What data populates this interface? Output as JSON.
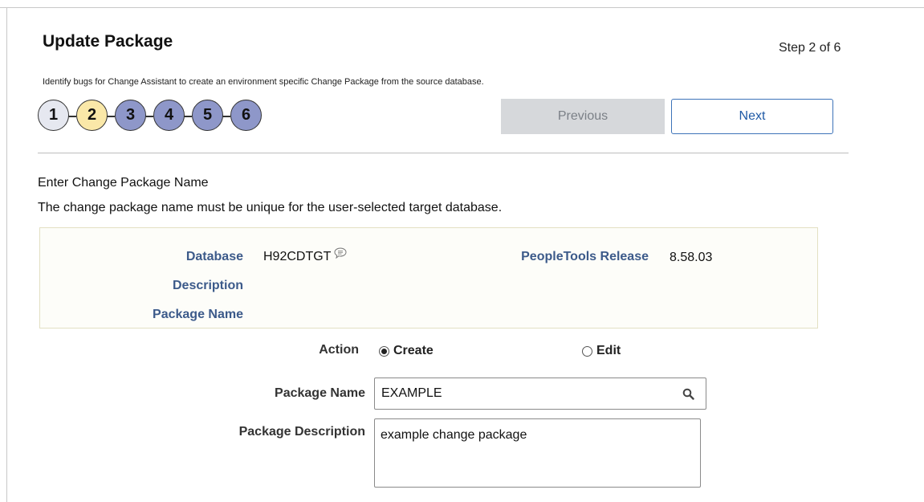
{
  "header": {
    "title": "Update Package",
    "step_indicator": "Step 2 of 6",
    "instructions": "Identify bugs for Change Assistant to create an environment specific Change Package from the source database."
  },
  "steps": [
    {
      "label": "1",
      "state": "complete",
      "color": "#e6e8f0"
    },
    {
      "label": "2",
      "state": "current",
      "color": "#fae8a8"
    },
    {
      "label": "3",
      "state": "upcoming",
      "color": "#8e97c9"
    },
    {
      "label": "4",
      "state": "upcoming",
      "color": "#8e97c9"
    },
    {
      "label": "5",
      "state": "upcoming",
      "color": "#8e97c9"
    },
    {
      "label": "6",
      "state": "upcoming",
      "color": "#8e97c9"
    }
  ],
  "navigation": {
    "previous_label": "Previous",
    "previous_disabled": true,
    "next_label": "Next"
  },
  "section": {
    "title": "Enter Change Package Name",
    "note": "The change package name must be unique for the user-selected target database."
  },
  "info": {
    "database_label": "Database",
    "database_value": "H92CDTGT",
    "database_icon": "comment-bubble-icon",
    "description_label": "Description",
    "package_name_label": "Package Name",
    "peopletools_label": "PeopleTools Release",
    "peopletools_value": "8.58.03"
  },
  "form": {
    "action_label": "Action",
    "action_options": [
      "Create",
      "Edit"
    ],
    "action_selected": "Create",
    "package_name_label": "Package Name",
    "package_name_value": "EXAMPLE",
    "package_name_icon": "search-icon",
    "package_description_label": "Package Description",
    "package_description_value": "example change package"
  },
  "colors": {
    "label_blue": "#3c5a8a",
    "button_border": "#3d73b9",
    "disabled_button": "#d6d8db"
  }
}
